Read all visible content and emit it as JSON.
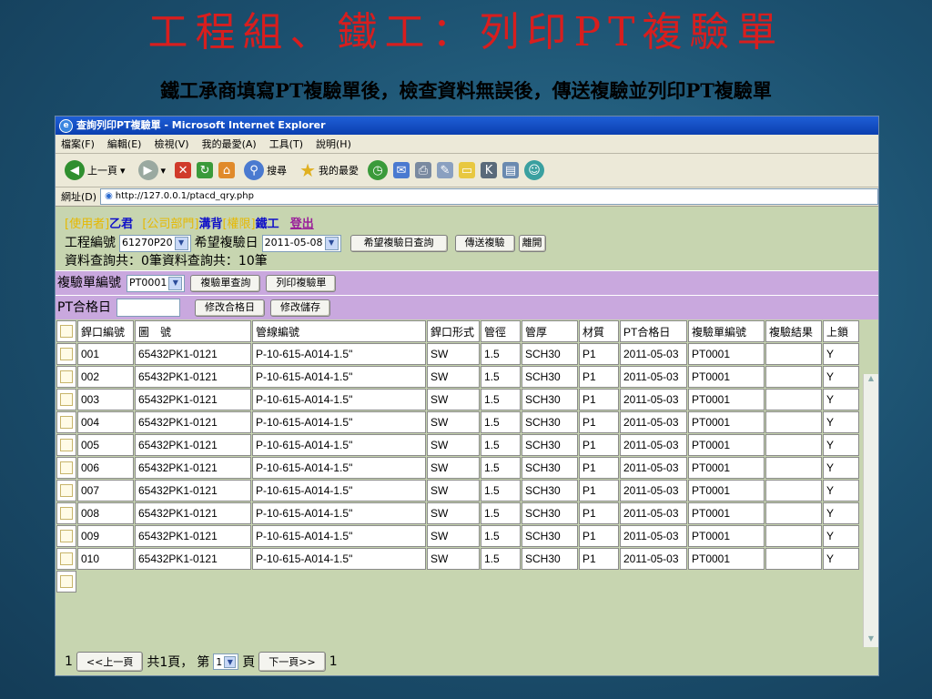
{
  "slide": {
    "title": "工程組、鐵工：列印PT複驗單",
    "subtitle": "鐵工承商填寫PT複驗單後，檢查資料無誤後，傳送複驗並列印PT複驗單"
  },
  "window": {
    "title": "查詢列印PT複驗單 - Microsoft Internet Explorer",
    "menu": [
      "檔案(F)",
      "編輯(E)",
      "檢視(V)",
      "我的最愛(A)",
      "工具(T)",
      "說明(H)"
    ],
    "toolbar": {
      "back": "上一頁",
      "search": "搜尋",
      "favorites": "我的最愛"
    },
    "address_label": "網址(D)",
    "address": "http://127.0.0.1/ptacd_qry.php"
  },
  "user": {
    "user_label": "[使用者]",
    "user_name": "乙君",
    "dept_label": "[公司部門]",
    "dept_name": "溝背",
    "perm_label": "[權限]",
    "perm_name": "鐵工",
    "logout": "登出"
  },
  "filter": {
    "project_label": "工程編號",
    "project_value": "61270P20",
    "date_label": "希望複驗日",
    "date_value": "2011-05-08",
    "date_query_btn": "希望複驗日查詢",
    "send_btn": "傳送複驗",
    "leave_btn": "離開"
  },
  "count_text": "資料查詢共：0筆資料查詢共：10筆",
  "form": {
    "retest_no_label": "複驗單編號",
    "retest_no_value": "PT0001",
    "query_btn": "複驗單查詢",
    "print_btn": "列印複驗單",
    "pass_date_label": "PT合格日",
    "modify_date_btn": "修改合格日",
    "save_btn": "修改儲存"
  },
  "table": {
    "headers": [
      "銲口編號",
      "圖　號",
      "管線編號",
      "銲口形式",
      "管徑",
      "管厚",
      "材質",
      "PT合格日",
      "複驗單編號",
      "複驗結果",
      "上鎖"
    ],
    "rows": [
      [
        "001",
        "65432PK1-0121",
        "P-10-615-A014-1.5\"",
        "SW",
        "1.5",
        "SCH30",
        "P1",
        "2011-05-03",
        "PT0001",
        "",
        "Y"
      ],
      [
        "002",
        "65432PK1-0121",
        "P-10-615-A014-1.5\"",
        "SW",
        "1.5",
        "SCH30",
        "P1",
        "2011-05-03",
        "PT0001",
        "",
        "Y"
      ],
      [
        "003",
        "65432PK1-0121",
        "P-10-615-A014-1.5\"",
        "SW",
        "1.5",
        "SCH30",
        "P1",
        "2011-05-03",
        "PT0001",
        "",
        "Y"
      ],
      [
        "004",
        "65432PK1-0121",
        "P-10-615-A014-1.5\"",
        "SW",
        "1.5",
        "SCH30",
        "P1",
        "2011-05-03",
        "PT0001",
        "",
        "Y"
      ],
      [
        "005",
        "65432PK1-0121",
        "P-10-615-A014-1.5\"",
        "SW",
        "1.5",
        "SCH30",
        "P1",
        "2011-05-03",
        "PT0001",
        "",
        "Y"
      ],
      [
        "006",
        "65432PK1-0121",
        "P-10-615-A014-1.5\"",
        "SW",
        "1.5",
        "SCH30",
        "P1",
        "2011-05-03",
        "PT0001",
        "",
        "Y"
      ],
      [
        "007",
        "65432PK1-0121",
        "P-10-615-A014-1.5\"",
        "SW",
        "1.5",
        "SCH30",
        "P1",
        "2011-05-03",
        "PT0001",
        "",
        "Y"
      ],
      [
        "008",
        "65432PK1-0121",
        "P-10-615-A014-1.5\"",
        "SW",
        "1.5",
        "SCH30",
        "P1",
        "2011-05-03",
        "PT0001",
        "",
        "Y"
      ],
      [
        "009",
        "65432PK1-0121",
        "P-10-615-A014-1.5\"",
        "SW",
        "1.5",
        "SCH30",
        "P1",
        "2011-05-03",
        "PT0001",
        "",
        "Y"
      ],
      [
        "010",
        "65432PK1-0121",
        "P-10-615-A014-1.5\"",
        "SW",
        "1.5",
        "SCH30",
        "P1",
        "2011-05-03",
        "PT0001",
        "",
        "Y"
      ]
    ]
  },
  "pager": {
    "start": "1",
    "prev": "<<上一頁",
    "total": "共1頁，",
    "page_prefix": "第",
    "page_value": "1",
    "page_suffix": "頁",
    "next": "下一頁>>",
    "end": "1"
  },
  "colors": {
    "title": "#d81e1e",
    "purple_bar": "#c9a8de",
    "page_bg": "#c7d5b0"
  }
}
